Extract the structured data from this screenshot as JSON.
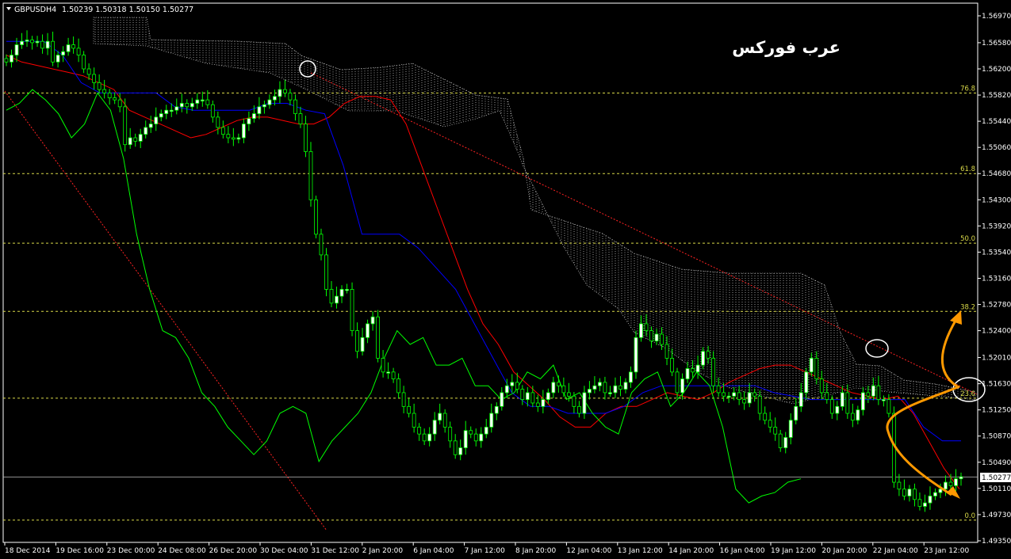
{
  "header": {
    "symbol": "GBPUSD",
    "timeframe": "H4",
    "ohlc": "1.50239 1.50318 1.50150 1.50277"
  },
  "watermark": "عرب فوركس",
  "colors": {
    "background": "#000000",
    "bull_candle": "#ffffff",
    "bear_candle": "#000000",
    "wick": "#00ff00",
    "tenkan": "#ff0000",
    "kijun": "#0000ff",
    "chikou": "#00ff00",
    "fib_line": "#d9d948",
    "trendline": "#ff2222",
    "annotation_arrow": "#ff9900"
  },
  "chart_data": {
    "type": "candlestick",
    "symbol": "GBPUSD",
    "timeframe": "H4",
    "ylim": [
      1.4935,
      1.5697
    ],
    "y_ticks": [
      "1.56970",
      "1.56580",
      "1.56200",
      "1.55820",
      "1.55440",
      "1.55060",
      "1.54680",
      "1.54300",
      "1.53920",
      "1.53540",
      "1.53160",
      "1.52780",
      "1.52400",
      "1.52010",
      "1.51630",
      "1.51250",
      "1.50870",
      "1.50490",
      "1.50110",
      "1.49730",
      "1.49350"
    ],
    "x_ticks": [
      "18 Dec 2014",
      "19 Dec 16:00",
      "23 Dec 00:00",
      "24 Dec 08:00",
      "26 Dec 20:00",
      "30 Dec 04:00",
      "31 Dec 12:00",
      "2 Jan 20:00",
      "6 Jan 04:00",
      "7 Jan 12:00",
      "8 Jan 20:00",
      "12 Jan 04:00",
      "13 Jan 12:00",
      "14 Jan 20:00",
      "16 Jan 04:00",
      "19 Jan 12:00",
      "20 Jan 20:00",
      "22 Jan 04:00",
      "23 Jan 12:00"
    ],
    "current_price": "1.50277",
    "fibonacci": [
      {
        "label": "76.8",
        "price": 1.5585
      },
      {
        "label": "61.8",
        "price": 1.5468
      },
      {
        "label": "50.0",
        "price": 1.5367
      },
      {
        "label": "38.2",
        "price": 1.5268
      },
      {
        "label": "23.6",
        "price": 1.5142
      },
      {
        "label": "0.0",
        "price": 1.4965
      }
    ],
    "close_path": [
      1.563,
      1.564,
      1.5655,
      1.566,
      1.5662,
      1.5658,
      1.566,
      1.565,
      1.566,
      1.563,
      1.564,
      1.5645,
      1.5655,
      1.565,
      1.564,
      1.562,
      1.5612,
      1.56,
      1.559,
      1.5585,
      1.5578,
      1.5575,
      1.5565,
      1.551,
      1.552,
      1.5515,
      1.5525,
      1.5535,
      1.554,
      1.555,
      1.5555,
      1.556,
      1.556,
      1.5565,
      1.557,
      1.5565,
      1.557,
      1.5575,
      1.5575,
      1.5568,
      1.555,
      1.5535,
      1.5525,
      1.552,
      1.5518,
      1.552,
      1.554,
      1.5548,
      1.5555,
      1.5565,
      1.5568,
      1.5575,
      1.558,
      1.559,
      1.5585,
      1.5575,
      1.5555,
      1.554,
      1.55,
      1.543,
      1.538,
      1.535,
      1.53,
      1.528,
      1.529,
      1.53,
      1.53,
      1.524,
      1.521,
      1.523,
      1.525,
      1.526,
      1.52,
      1.518,
      1.518,
      1.517,
      1.515,
      1.513,
      1.512,
      1.51,
      1.509,
      1.508,
      1.509,
      1.511,
      1.512,
      1.51,
      1.508,
      1.506,
      1.507,
      1.5095,
      1.509,
      1.508,
      1.509,
      1.51,
      1.512,
      1.513,
      1.515,
      1.516,
      1.5165,
      1.5155,
      1.514,
      1.515,
      1.5135,
      1.513,
      1.514,
      1.515,
      1.5165,
      1.516,
      1.515,
      1.5145,
      1.513,
      1.512,
      1.515,
      1.5155,
      1.516,
      1.5165,
      1.515,
      1.515,
      1.516,
      1.5155,
      1.5165,
      1.518,
      1.523,
      1.525,
      1.524,
      1.5225,
      1.5235,
      1.522,
      1.52,
      1.518,
      1.515,
      1.517,
      1.5185,
      1.518,
      1.519,
      1.521,
      1.52,
      1.516,
      1.515,
      1.5145,
      1.5145,
      1.515,
      1.514,
      1.5135,
      1.515,
      1.5145,
      1.512,
      1.511,
      1.51,
      1.509,
      1.507,
      1.5085,
      1.511,
      1.513,
      1.515,
      1.518,
      1.52,
      1.517,
      1.515,
      1.514,
      1.512,
      1.513,
      1.515,
      1.512,
      1.511,
      1.5125,
      1.515,
      1.5145,
      1.516,
      1.514,
      1.514,
      1.512,
      1.502,
      1.501,
      1.5,
      1.501,
      1.4995,
      1.4985,
      1.499,
      1.5,
      1.5005,
      1.501,
      1.502,
      1.5015,
      1.5025,
      1.5028
    ],
    "series": [
      {
        "name": "tenkan",
        "values": [
          1.564,
          1.563,
          1.5625,
          1.562,
          1.5615,
          1.561,
          1.56,
          1.559,
          1.556,
          1.555,
          1.554,
          1.553,
          1.552,
          1.5525,
          1.5535,
          1.5545,
          1.555,
          1.555,
          1.5545,
          1.554,
          1.554,
          1.555,
          1.557,
          1.558,
          1.558,
          1.5575,
          1.554,
          1.548,
          1.542,
          1.536,
          1.53,
          1.525,
          1.522,
          1.518,
          1.516,
          1.514,
          1.5115,
          1.51,
          1.51,
          1.512,
          1.513,
          1.513,
          1.514,
          1.515,
          1.5145,
          1.514,
          1.515,
          1.5165,
          1.5175,
          1.5185,
          1.519,
          1.519,
          1.518,
          1.517,
          1.516,
          1.515,
          1.5145,
          1.514,
          1.5145,
          1.512,
          1.508,
          1.504,
          1.501
        ]
      },
      {
        "name": "kijun",
        "values": [
          1.566,
          1.566,
          1.566,
          1.564,
          1.56,
          1.5585,
          1.5585,
          1.5585,
          1.5585,
          1.5565,
          1.556,
          1.556,
          1.556,
          1.556,
          1.557,
          1.557,
          1.556,
          1.5555,
          1.548,
          1.538,
          1.538,
          1.538,
          1.536,
          1.533,
          1.53,
          1.525,
          1.52,
          1.515,
          1.513,
          1.513,
          1.512,
          1.512,
          1.512,
          1.513,
          1.515,
          1.516,
          1.516,
          1.516,
          1.516,
          1.516,
          1.516,
          1.515,
          1.5145,
          1.514,
          1.514,
          1.514,
          1.514,
          1.514,
          1.514,
          1.51,
          1.508,
          1.508
        ]
      },
      {
        "name": "chikou",
        "values": [
          1.556,
          1.557,
          1.559,
          1.5575,
          1.5555,
          1.552,
          1.554,
          1.5585,
          1.556,
          1.549,
          1.538,
          1.53,
          1.524,
          1.523,
          1.52,
          1.515,
          1.513,
          1.51,
          1.508,
          1.506,
          1.508,
          1.512,
          1.513,
          1.512,
          1.505,
          1.508,
          1.51,
          1.512,
          1.515,
          1.52,
          1.524,
          1.522,
          1.523,
          1.519,
          1.519,
          1.52,
          1.516,
          1.516,
          1.514,
          1.515,
          1.518,
          1.517,
          1.519,
          1.514,
          1.515,
          1.512,
          1.51,
          1.509,
          1.515,
          1.517,
          1.518,
          1.513,
          1.515,
          1.518,
          1.516,
          1.51,
          1.501,
          1.499,
          1.5,
          1.5005,
          1.502,
          1.5025
        ]
      }
    ],
    "annotations": [
      "circle",
      "circle",
      "circle",
      "arrow-up",
      "arrow-down"
    ]
  }
}
